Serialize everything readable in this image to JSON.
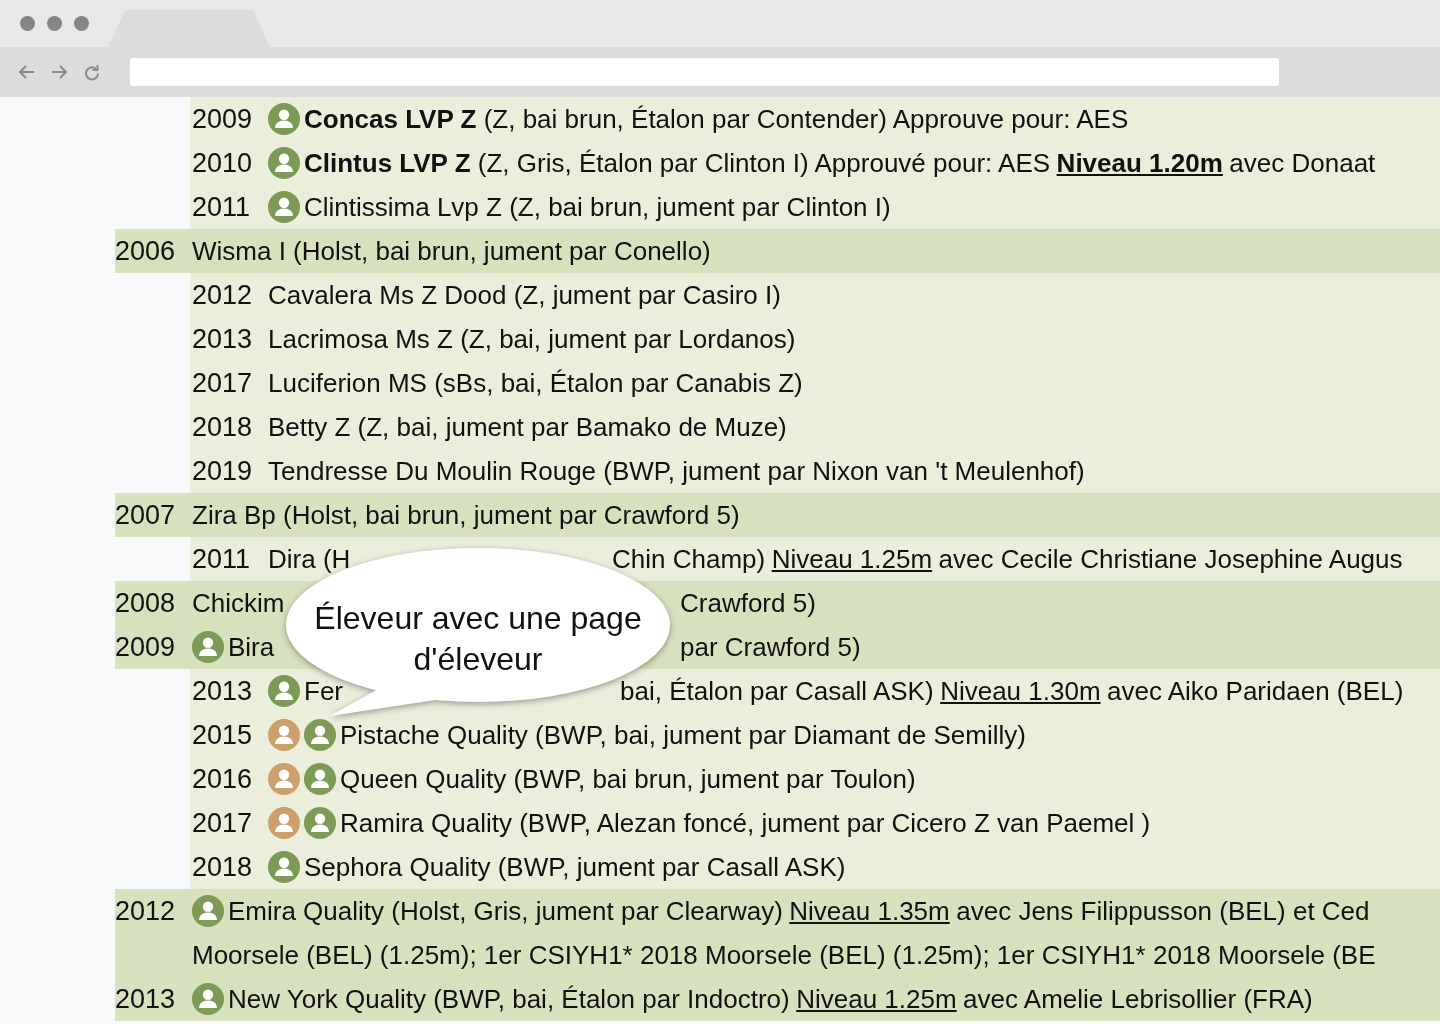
{
  "continued_offspring": [
    {
      "year": "2009",
      "badges": [
        {
          "color": "#7d9b56"
        }
      ],
      "text": "**Concas LVP Z** (Z, bai brun, Étalon par Contender) Approuve pour: AES"
    },
    {
      "year": "2010",
      "badges": [
        {
          "color": "#7d9b56"
        }
      ],
      "text": "**Clintus LVP Z** (Z, Gris, Étalon par Clinton I) Approuvé pour: AES",
      "link": {
        "text": "Niveau 1.20m",
        "bold": true
      },
      "text_after": "avec Donaat"
    },
    {
      "year": "2011",
      "badges": [
        {
          "color": "#7d9b56"
        }
      ],
      "text": "Clintissima Lvp Z (Z, bai brun, jument par Clinton I)"
    }
  ],
  "horses": [
    {
      "year": "2006",
      "text": "Wisma I (Holst, bai brun, jument par Conello)",
      "children": [
        {
          "year": "2012",
          "text": "Cavalera Ms Z Dood (Z, jument par Casiro I)"
        },
        {
          "year": "2013",
          "text": "Lacrimosa Ms Z (Z, bai, jument par Lordanos)"
        },
        {
          "year": "2017",
          "text": "Luciferion MS (sBs, bai, Étalon par Canabis Z)"
        },
        {
          "year": "2018",
          "text": "Betty Z (Z, bai, jument par Bamako de Muze)"
        },
        {
          "year": "2019",
          "text": "Tendresse Du Moulin Rouge (BWP, jument par Nixon van 't Meulenhof)"
        }
      ]
    },
    {
      "year": "2007",
      "text": "Zira Bp (Holst, bai brun, jument par Crawford 5)",
      "children": [
        {
          "year": "2011",
          "text": "Dira (H",
          "resumes": "Chin Champ)",
          "link": {
            "text": "Niveau 1.25m",
            "bold": false
          },
          "text_after": "avec Cecile Christiane Josephine Augus"
        }
      ]
    },
    {
      "year": "2008",
      "text": "Chickim",
      "resumes": "Crawford 5)"
    },
    {
      "year": "2009",
      "badges": [
        {
          "color": "#7d9b56"
        }
      ],
      "text": "Bira",
      "resumes": "par Crawford 5)",
      "children": [
        {
          "year": "2013",
          "badges": [
            {
              "color": "#7d9b56"
            }
          ],
          "text": "Fer",
          "resumes": "bai, Étalon par Casall ASK)",
          "link": {
            "text": "Niveau 1.30m",
            "bold": false
          },
          "text_after": "avec Aiko Paridaen (BEL)"
        },
        {
          "year": "2015",
          "badges": [
            {
              "color": "#cda06b"
            },
            {
              "color": "#7d9b56"
            }
          ],
          "text": "Pistache Quality (BWP, bai, jument par Diamant de Semilly)"
        },
        {
          "year": "2016",
          "badges": [
            {
              "color": "#cda06b"
            },
            {
              "color": "#7d9b56"
            }
          ],
          "text": "Queen Quality (BWP, bai brun, jument par Toulon)"
        },
        {
          "year": "2017",
          "badges": [
            {
              "color": "#cda06b"
            },
            {
              "color": "#7d9b56"
            }
          ],
          "text": "Ramira Quality (BWP, Alezan foncé, jument par Cicero Z van Paemel )"
        },
        {
          "year": "2018",
          "badges": [
            {
              "color": "#7d9b56"
            }
          ],
          "text": "Sephora Quality (BWP, jument par Casall ASK)"
        }
      ]
    },
    {
      "year": "2012",
      "badges": [
        {
          "color": "#7d9b56"
        }
      ],
      "text": "Emira Quality (Holst, Gris, jument par Clearway)",
      "link": {
        "text": "Niveau 1.35m",
        "bold": false
      },
      "text_after": "avec Jens Filippusson (BEL) et Ced",
      "continuation": "Moorsele (BEL) (1.25m); 1er CSIYH1* 2018 Moorsele (BEL) (1.25m); 1er CSIYH1* 2018 Moorsele (BE"
    },
    {
      "year": "2013",
      "badges": [
        {
          "color": "#7d9b56"
        }
      ],
      "text": "New York Quality (BWP, bai, Étalon par Indoctro)",
      "link": {
        "text": "Niveau 1.25m",
        "bold": false
      },
      "text_after": "avec Amelie Lebrisollier (FRA)"
    }
  ],
  "callout": {
    "text": "Éleveur avec une page d'éleveur"
  }
}
